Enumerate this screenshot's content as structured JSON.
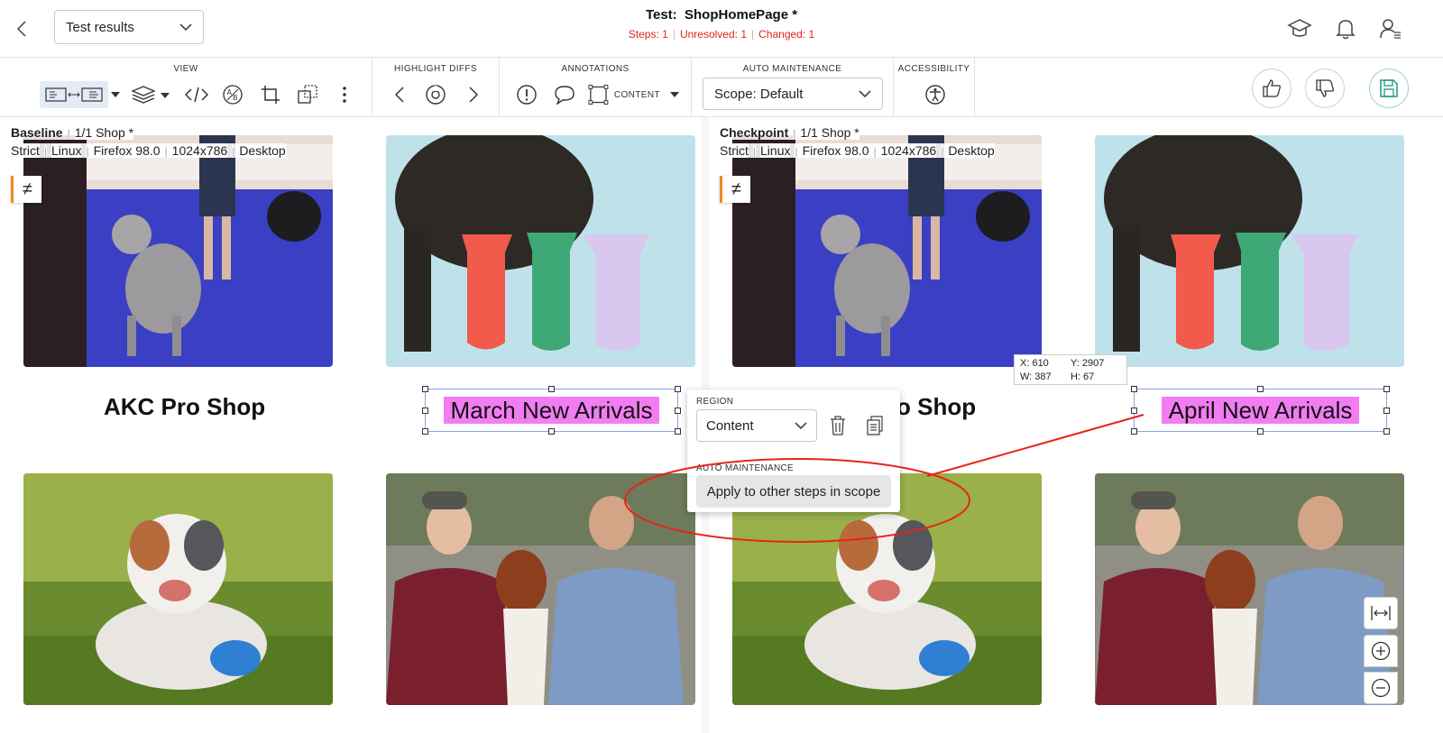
{
  "header": {
    "results_dropdown": "Test results",
    "test_label": "Test:",
    "test_name": "ShopHomePage *",
    "stats": {
      "steps": "Steps: 1",
      "unresolved": "Unresolved: 1",
      "changed": "Changed: 1"
    },
    "icons": [
      "back-icon",
      "graduation-cap-icon",
      "bell-icon",
      "user-settings-icon"
    ]
  },
  "toolbar": {
    "groups": {
      "view": "VIEW",
      "highlight": "HIGHLIGHT DIFFS",
      "annotations": "ANNOTATIONS",
      "auto_maintenance": "AUTO MAINTENANCE",
      "accessibility": "ACCESSIBILITY"
    },
    "content_label": "CONTENT",
    "scope_value": "Scope: Default"
  },
  "baseline": {
    "name": "Baseline",
    "step": "1/1 Shop *",
    "meta": [
      "Strict",
      "Linux",
      "Firefox 98.0",
      "1024x786",
      "Desktop"
    ],
    "card_title": "AKC Pro Shop",
    "region_text": "March New Arrivals"
  },
  "checkpoint": {
    "name": "Checkpoint",
    "step": "1/1 Shop *",
    "meta": [
      "Strict",
      "Linux",
      "Firefox 98.0",
      "1024x786",
      "Desktop"
    ],
    "card_title_partial": "o Shop",
    "region_text": "April New Arrivals"
  },
  "coords": {
    "x": "X: 610",
    "y": "Y: 2907",
    "w": "W: 387",
    "h": "H: 67"
  },
  "region_popup": {
    "region_label": "REGION",
    "region_value": "Content",
    "auto_label": "AUTO MAINTENANCE",
    "apply_button": "Apply to other steps in scope"
  },
  "colors": {
    "diff_highlight": "#f27df2",
    "error_red": "#e0241b",
    "annotation_red": "#e8231a",
    "accent_orange": "#f08a1c"
  }
}
